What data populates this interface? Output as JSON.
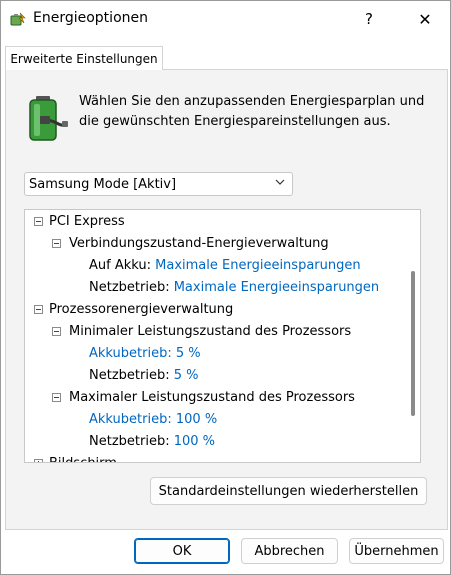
{
  "window": {
    "title": "Energieoptionen",
    "help_glyph": "?",
    "close_glyph": "✕"
  },
  "tab": {
    "label": "Erweiterte Einstellungen"
  },
  "intro": {
    "text": "Wählen Sie den anzupassenden Energiesparplan und die gewünschten Energiespareinstellungen aus."
  },
  "plan_select": {
    "value": "Samsung Mode [Aktiv]"
  },
  "tree": {
    "pci_express": "PCI Express",
    "link_state": "Verbindungszustand-Energieverwaltung",
    "link_battery_label": "Auf Akku:",
    "link_battery_value": "Maximale Energieeinsparungen",
    "link_ac_label": "Netzbetrieb:",
    "link_ac_value": "Maximale Energieeinsparungen",
    "processor": "Prozessorenergieverwaltung",
    "min_state": "Minimaler Leistungszustand des Prozessors",
    "min_battery_label": "Akkubetrieb:",
    "min_battery_value": "5 %",
    "min_ac_label": "Netzbetrieb:",
    "min_ac_value": "5 %",
    "max_state": "Maximaler Leistungszustand des Prozessors",
    "max_battery_label": "Akkubetrieb:",
    "max_battery_value": "100 %",
    "max_ac_label": "Netzbetrieb:",
    "max_ac_value": "100 %",
    "display": "Bildschirm"
  },
  "buttons": {
    "restore": "Standardeinstellungen wiederherstellen",
    "ok": "OK",
    "cancel": "Abbrechen",
    "apply": "Übernehmen"
  },
  "colors": {
    "link_blue": "#0067c0",
    "panel_bg": "#f3f3f3"
  }
}
